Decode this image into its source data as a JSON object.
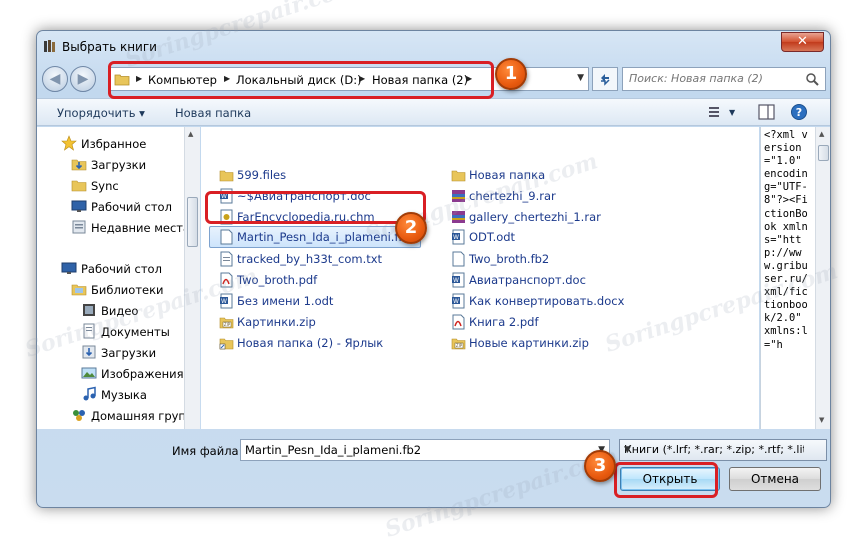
{
  "window": {
    "title": "Выбрать книги",
    "close_label": "✕"
  },
  "breadcrumb": {
    "items": [
      "Компьютер",
      "Локальный диск (D:)",
      "Новая папка (2)"
    ]
  },
  "search": {
    "placeholder": "Поиск: Новая папка (2)"
  },
  "toolbar": {
    "organize_label": "Упорядочить ▾",
    "new_folder_label": "Новая папка"
  },
  "sidebar": {
    "items": [
      {
        "label": "Избранное",
        "icon": "star-icon"
      },
      {
        "label": "Загрузки",
        "icon": "downloads-icon"
      },
      {
        "label": "Sync",
        "icon": "folder-icon"
      },
      {
        "label": "Рабочий стол",
        "icon": "desktop-icon"
      },
      {
        "label": "Недавние места",
        "icon": "recent-icon"
      },
      {
        "label": "Рабочий стол",
        "icon": "desktop-icon"
      },
      {
        "label": "Библиотеки",
        "icon": "library-icon"
      },
      {
        "label": "Видео",
        "icon": "video-icon"
      },
      {
        "label": "Документы",
        "icon": "documents-icon"
      },
      {
        "label": "Загрузки",
        "icon": "downloads-icon"
      },
      {
        "label": "Изображения",
        "icon": "pictures-icon"
      },
      {
        "label": "Музыка",
        "icon": "music-icon"
      },
      {
        "label": "Домашняя груп",
        "icon": "homegroup-icon"
      }
    ]
  },
  "files": {
    "col1": [
      {
        "name": "599.files",
        "icon": "folder-icon"
      },
      {
        "name": "~$Авиатранспорт.doc",
        "icon": "word-icon"
      },
      {
        "name": "FarEncyclopedia.ru.chm",
        "icon": "chm-icon"
      },
      {
        "name": "Martin_Pesn_Ida_i_plameni.fb2",
        "icon": "file-icon"
      },
      {
        "name": "tracked_by_h33t_com.txt",
        "icon": "text-icon"
      },
      {
        "name": "Two_broth.pdf",
        "icon": "pdf-icon"
      },
      {
        "name": "Без имени 1.odt",
        "icon": "word-icon"
      },
      {
        "name": "Картинки.zip",
        "icon": "zip-icon"
      },
      {
        "name": "Новая папка (2) - Ярлык",
        "icon": "shortcut-icon"
      }
    ],
    "col2": [
      {
        "name": "Новая папка",
        "icon": "folder-icon"
      },
      {
        "name": "chertezhi_9.rar",
        "icon": "rar-icon"
      },
      {
        "name": "gallery_chertezhi_1.rar",
        "icon": "rar-icon"
      },
      {
        "name": "ODT.odt",
        "icon": "word-icon"
      },
      {
        "name": "Two_broth.fb2",
        "icon": "file-icon"
      },
      {
        "name": "Авиатранспорт.doc",
        "icon": "word-icon"
      },
      {
        "name": "Как конвертировать.docx",
        "icon": "word-icon"
      },
      {
        "name": "Книга 2.pdf",
        "icon": "pdf-icon"
      },
      {
        "name": "Новые картинки.zip",
        "icon": "zip-icon"
      }
    ]
  },
  "preview": {
    "text": "<?xml version=\"1.0\" encoding=\"UTF-8\"?><FictionBook xmlns=\"http://www.gribuser.ru/xml/fictionbook/2.0\" xmlns:l=\"h"
  },
  "footer": {
    "filename_label": "Имя файла:",
    "filename_value": "Martin_Pesn_Ida_i_plameni.fb2",
    "filter_label": "Книги (*.lrf; *.rar; *.zip; *.rtf; *.lit",
    "open_label": "Открыть",
    "cancel_label": "Отмена"
  },
  "annotations": {
    "badge1": "1",
    "badge2": "2",
    "badge3": "3",
    "color": "#d91f24"
  },
  "watermark": "Soringpcrepair.com"
}
